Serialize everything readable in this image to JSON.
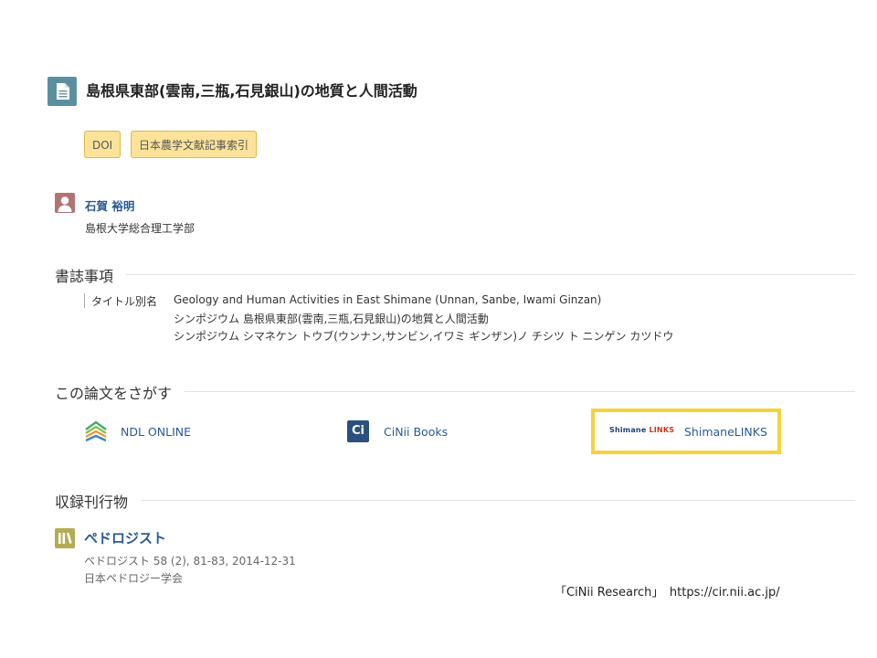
{
  "title": "島根県東部(雲南,三瓶,石見銀山)の地質と人間活動",
  "badges": {
    "doi": "DOI",
    "naro": "日本農学文献記事索引"
  },
  "author": {
    "name": "石賀 裕明",
    "affiliation": "島根大学総合理工学部"
  },
  "bibliography": {
    "heading": "書誌事項",
    "alt_title_label": "タイトル別名",
    "alt_titles": [
      "Geology and Human Activities in East Shimane (Unnan, Sanbe, Iwami Ginzan)",
      "シンポジウム 島根県東部(雲南,三瓶,石見銀山)の地質と人間活動",
      "シンポジウム シマネケン トウブ(ウンナン,サンビン,イワミ ギンザン)ノ チシツ ト ニンゲン カツドウ"
    ]
  },
  "search": {
    "heading": "この論文をさがす",
    "links": {
      "ndl": "NDL ONLINE",
      "cinii_books": "CiNii Books",
      "shimane": "ShimaneLINKS"
    },
    "shimane_logo": {
      "part1": "Shimane ",
      "part2": "LINKS"
    },
    "cinii_icon_text": "Ci"
  },
  "journal": {
    "heading": "収録刊行物",
    "title": "ペドロジスト",
    "volume": "ペドロジスト 58 (2), 81-83, 2014-12-31",
    "publisher": "日本ペドロジー学会"
  },
  "credit": "「CiNii Research」　https://cir.nii.ac.jp/",
  "colors": {
    "highlight_box": "#f7d23a",
    "badge_bg": "#fde39a",
    "link": "#2a5a94"
  }
}
